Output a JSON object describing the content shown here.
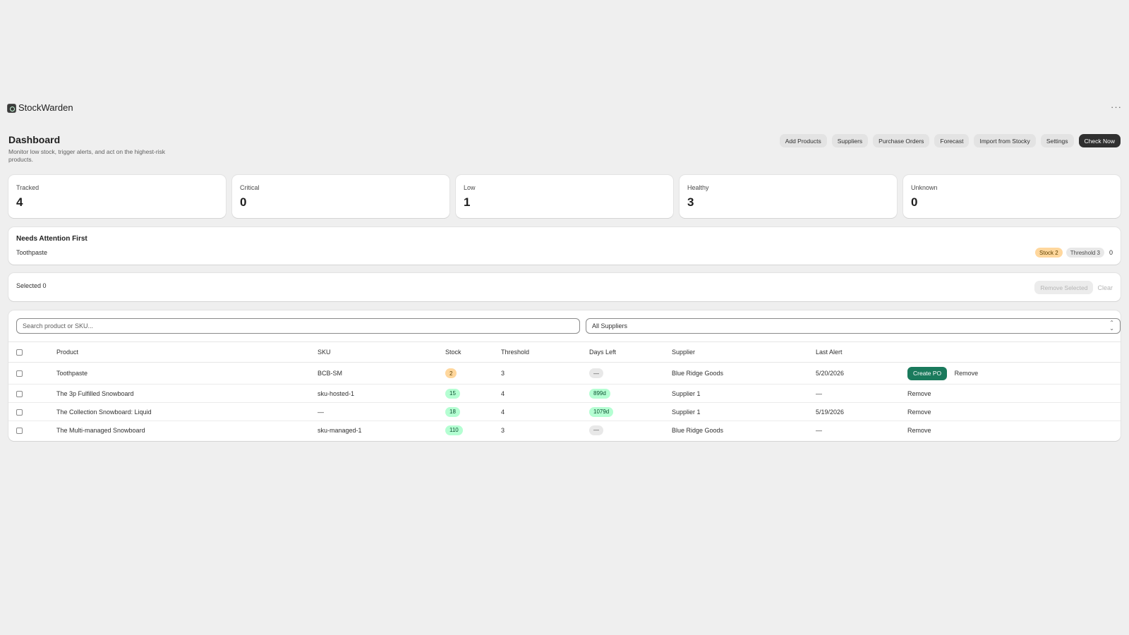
{
  "app": {
    "name": "StockWarden",
    "menu_icon": "more-horizontal-icon",
    "menu_label": "···"
  },
  "header": {
    "title": "Dashboard",
    "subtitle": "Monitor low stock, trigger alerts, and act on the highest-risk products.",
    "actions": [
      "Add Products",
      "Suppliers",
      "Purchase Orders",
      "Forecast",
      "Import from Stocky",
      "Settings",
      "Check Now"
    ]
  },
  "stats": [
    {
      "label": "Tracked",
      "value": "4"
    },
    {
      "label": "Critical",
      "value": "0"
    },
    {
      "label": "Low",
      "value": "1"
    },
    {
      "label": "Healthy",
      "value": "3"
    },
    {
      "label": "Unknown",
      "value": "0"
    }
  ],
  "attention": {
    "title": "Needs Attention First",
    "product": "Toothpaste",
    "stock_badge": "Stock 2",
    "threshold_badge": "Threshold 3",
    "count": "0"
  },
  "selection": {
    "text": "Selected 0",
    "remove_label": "Remove Selected",
    "clear_label": "Clear"
  },
  "filters": {
    "search_placeholder": "Search product or SKU...",
    "supplier_selected": "All Suppliers"
  },
  "table": {
    "columns": [
      "Product",
      "SKU",
      "Stock",
      "Threshold",
      "Days Left",
      "Supplier",
      "Last Alert"
    ],
    "rows": [
      {
        "product": "Toothpaste",
        "sku": "BCB-SM",
        "stock": "2",
        "stock_status": "warn",
        "threshold": "3",
        "days_left": "—",
        "days_status": "neutral",
        "supplier": "Blue Ridge Goods",
        "last_alert": "5/20/2026",
        "create_po": "Create PO",
        "remove": "Remove"
      },
      {
        "product": "The 3p Fulfilled Snowboard",
        "sku": "sku-hosted-1",
        "stock": "15",
        "stock_status": "success",
        "threshold": "4",
        "days_left": "899d",
        "days_status": "success",
        "supplier": "Supplier 1",
        "last_alert": "—",
        "remove": "Remove"
      },
      {
        "product": "The Collection Snowboard: Liquid",
        "sku": "—",
        "stock": "18",
        "stock_status": "success",
        "threshold": "4",
        "days_left": "1079d",
        "days_status": "success",
        "supplier": "Supplier 1",
        "last_alert": "5/19/2026",
        "remove": "Remove"
      },
      {
        "product": "The Multi-managed Snowboard",
        "sku": "sku-managed-1",
        "stock": "110",
        "stock_status": "success",
        "threshold": "3",
        "days_left": "—",
        "days_status": "neutral",
        "supplier": "Blue Ridge Goods",
        "last_alert": "—",
        "remove": "Remove"
      }
    ]
  },
  "colors": {
    "background": "#efefef",
    "primary_button": "#303030",
    "create_po": "#1a7a5c",
    "warn_badge": "#ffd79d",
    "success_badge": "#b4fed2"
  }
}
